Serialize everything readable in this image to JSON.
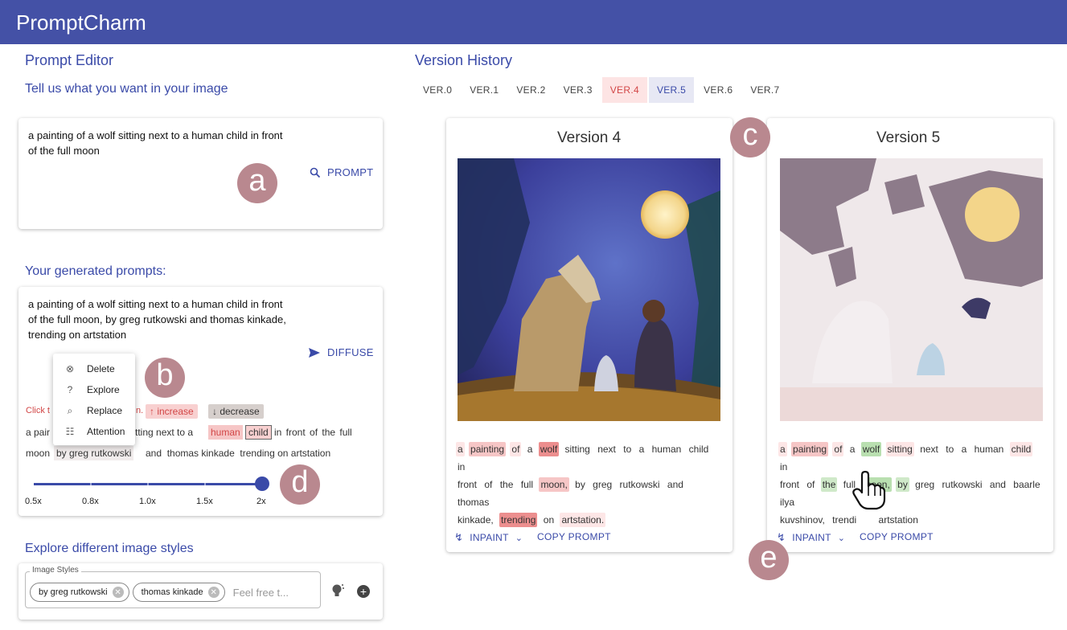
{
  "app": {
    "title": "PromptCharm"
  },
  "editor": {
    "heading": "Prompt Editor",
    "subheading": "Tell us what you want in your image",
    "input_text_line1": "a painting of a wolf sitting next to a human child in front",
    "input_text_line2": "of the full moon",
    "prompt_button": "PROMPT",
    "marker": "a"
  },
  "generated": {
    "heading": "Your generated prompts:",
    "line1": "a painting of a wolf sitting next to a human child in front",
    "line2": "of the full moon, by greg rutkowski and thomas kinkade,",
    "line3": "trending on artstation",
    "diffuse_button": "DIFFUSE",
    "marker": "b",
    "context_menu": [
      {
        "icon": "delete-icon",
        "label": "Delete"
      },
      {
        "icon": "explore-icon",
        "label": "Explore"
      },
      {
        "icon": "replace-icon",
        "label": "Replace"
      },
      {
        "icon": "attention-icon",
        "label": "Attention"
      }
    ],
    "hint_prefix": "Click t",
    "hint_suffix": "n.",
    "increase_label": "↑ increase",
    "decrease_label": "↓ decrease",
    "tokens_line1_a": "a pair",
    "tokens_line1_b": "tting next to a",
    "token_human": "human",
    "token_child": "child",
    "tokens_line1_c": "in front of the full",
    "tokens_line2_a": "moon",
    "tokens_line2_b": "by greg rutkowski",
    "tokens_line2_c": "and  thomas kinkade  trending on artstation",
    "slider": {
      "labels": [
        "0.5x",
        "0.8x",
        "1.0x",
        "1.5x",
        "2x"
      ],
      "value": "2x"
    },
    "marker_d": "d"
  },
  "styles": {
    "heading": "Explore different image styles",
    "field_label": "Image Styles",
    "chips": [
      "by greg rutkowski",
      "thomas kinkade"
    ],
    "placeholder": "Feel free t..."
  },
  "history": {
    "heading": "Version History",
    "tabs": [
      "VER.0",
      "VER.1",
      "VER.2",
      "VER.3",
      "VER.4",
      "VER.5",
      "VER.6",
      "VER.7"
    ],
    "marker_c": "c",
    "marker_e": "e",
    "inpaint_label": "INPAINT",
    "copy_label": "COPY PROMPT",
    "v4": {
      "title": "Version 4",
      "tokens": [
        "a",
        "painting",
        "of",
        "a",
        "wolf",
        "sitting",
        "next",
        "to",
        "a",
        "human",
        "child",
        "in",
        "front",
        "of",
        "the",
        "full",
        "moon,",
        "by",
        "greg",
        "rutkowski",
        "and",
        "thomas",
        "kinkade,",
        "trending",
        "on",
        "artstation."
      ]
    },
    "v5": {
      "title": "Version 5",
      "tokens": [
        "a",
        "painting",
        "of",
        "a",
        "wolf",
        "sitting",
        "next",
        "to",
        "a",
        "human",
        "child",
        "in",
        "front",
        "of",
        "the",
        "full",
        "moon,",
        "by",
        "greg",
        "rutkowski",
        "and",
        "baarle",
        "ilya",
        "kuvshinov,",
        "trendi",
        "artstation"
      ]
    }
  },
  "colors": {
    "brand": "#4451a6",
    "accent_red": "#d24646",
    "marker": "#b9888f"
  }
}
